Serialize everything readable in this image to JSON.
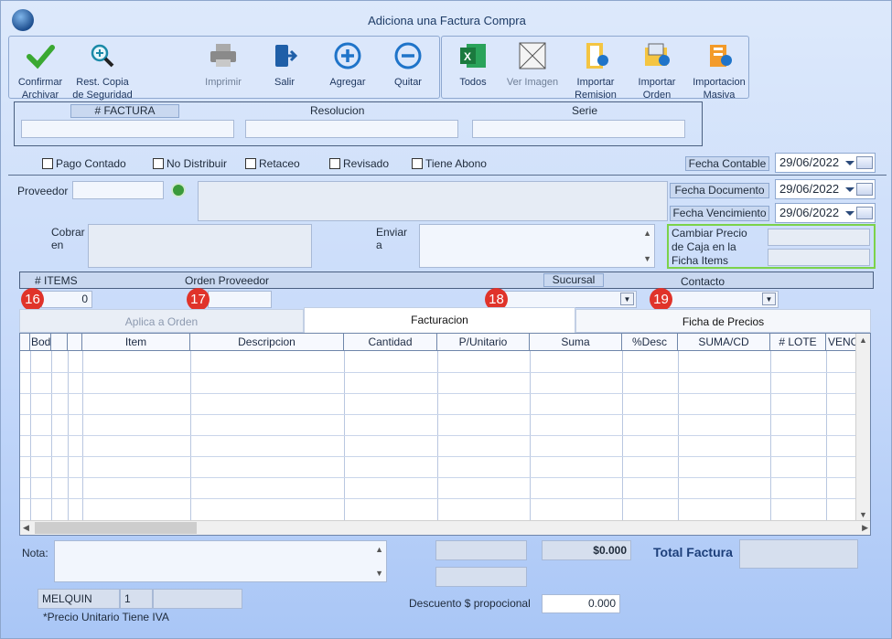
{
  "window": {
    "title": "Adiciona una Factura Compra"
  },
  "toolbar": {
    "confirm": [
      "Confirmar",
      "Archivar"
    ],
    "backup": [
      "Rest. Copia",
      "de Seguridad"
    ],
    "print": "Imprimir",
    "exit": "Salir",
    "add": "Agregar",
    "remove": "Quitar",
    "all": "Todos",
    "view_image": "Ver Imagen",
    "import_remision": [
      "Importar",
      "Remision"
    ],
    "import_orden": [
      "Importar",
      "Orden"
    ],
    "import_masiva": [
      "Importacion",
      "Masiva"
    ]
  },
  "invoice_header": {
    "factura": "# FACTURA",
    "resolucion": "Resolucion",
    "serie": "Serie"
  },
  "checkboxes": {
    "pago_contado": "Pago Contado",
    "no_distribuir": "No Distribuir",
    "retaceo": "Retaceo",
    "revisado": "Revisado",
    "tiene_abono": "Tiene Abono"
  },
  "dates": {
    "contable_label": "Fecha Contable",
    "contable_value": "29/06/2022",
    "documento_label": "Fecha Documento",
    "documento_value": "29/06/2022",
    "vencimiento_label": "Fecha Vencimiento",
    "vencimiento_value": "29/06/2022"
  },
  "provider": {
    "label": "Proveedor",
    "cobrar": [
      "Cobrar",
      "en"
    ],
    "enviar": [
      "Enviar",
      "a"
    ]
  },
  "price_change": [
    "Cambiar Precio",
    "de Caja en la",
    "Ficha Items"
  ],
  "items_bar": {
    "items": "# ITEMS",
    "orden": "Orden Proveedor",
    "sucursal": "Sucursal",
    "contacto": "Contacto",
    "items_count": "0"
  },
  "badges": [
    "16",
    "17",
    "18",
    "19"
  ],
  "tabs": {
    "aplica": "Aplica a Orden",
    "facturacion": "Facturacion",
    "ficha": "Ficha de Precios"
  },
  "grid_columns": [
    "Bodega",
    "",
    "",
    "Item",
    "Descripcion",
    "Cantidad",
    "P/Unitario",
    "Suma",
    "%Desc",
    "SUMA/CD",
    "# LOTE",
    "VENC"
  ],
  "footer": {
    "nota": "Nota:",
    "amount": "$0.000",
    "total_label": "Total Factura",
    "descuento_label": "Descuento $ propocional",
    "descuento_value": "0.000",
    "user": "MELQUIN",
    "user_num": "1",
    "note_iva": "*Precio Unitario Tiene IVA"
  },
  "colors": {
    "accent": "#e0332a",
    "highlight_border": "#7bd24a"
  }
}
